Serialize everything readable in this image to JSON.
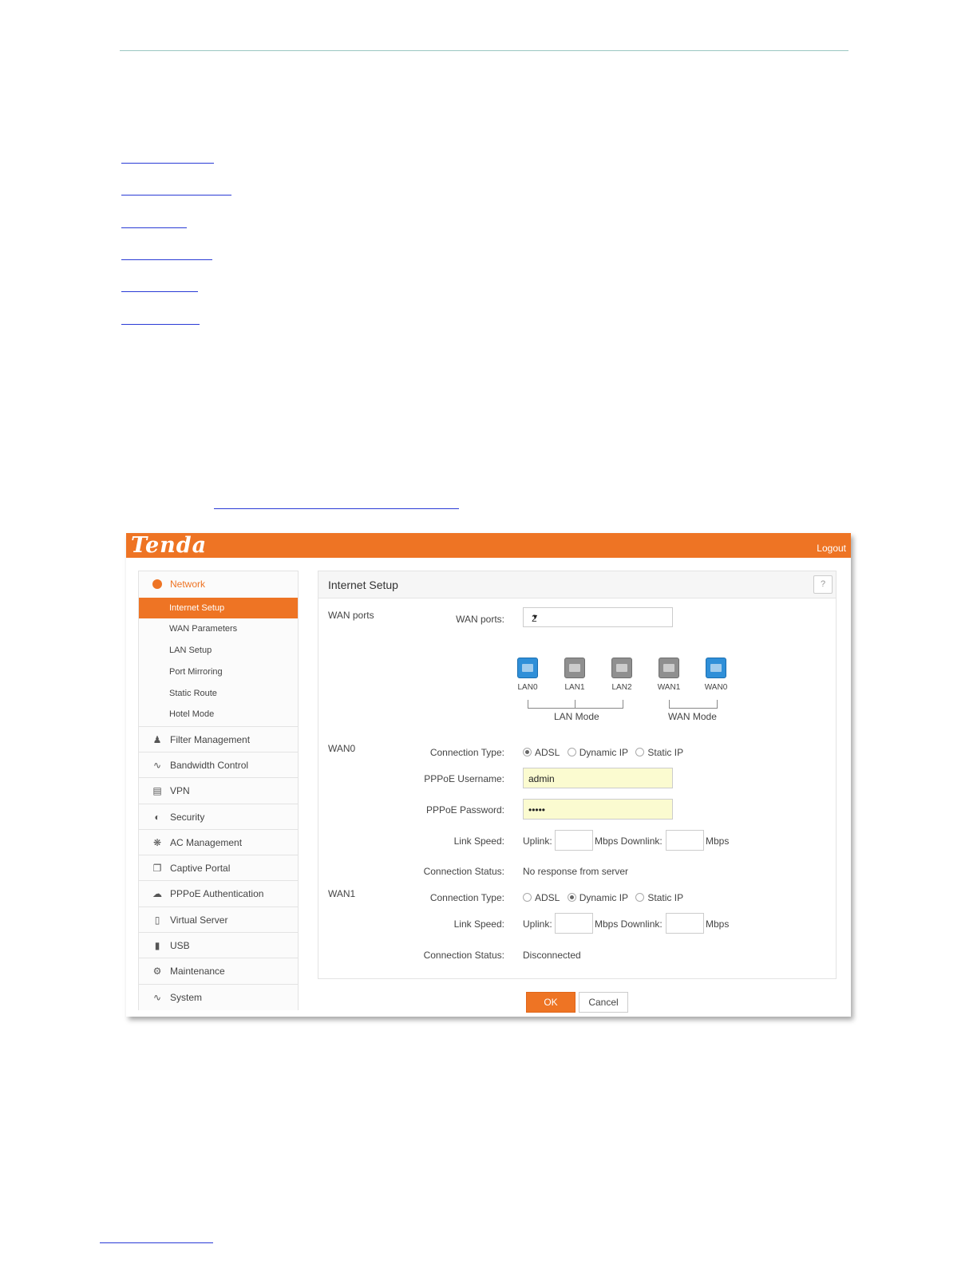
{
  "brand": {
    "logo": "Tenda",
    "accent": "#ee7424"
  },
  "header": {
    "logout": "Logout"
  },
  "sidebar": {
    "network": {
      "label": "Network",
      "icon": "globe-icon"
    },
    "network_items": [
      "Internet Setup",
      "WAN Parameters",
      "LAN Setup",
      "Port Mirroring",
      "Static Route",
      "Hotel Mode"
    ],
    "active_item": "Internet Setup",
    "menu": [
      {
        "label": "Filter Management",
        "icon": "user-filter-icon"
      },
      {
        "label": "Bandwidth Control",
        "icon": "chart-line-icon"
      },
      {
        "label": "VPN",
        "icon": "monitor-icon"
      },
      {
        "label": "Security",
        "icon": "shield-icon"
      },
      {
        "label": "AC Management",
        "icon": "antenna-icon"
      },
      {
        "label": "Captive Portal",
        "icon": "portal-icon"
      },
      {
        "label": "PPPoE Authentication",
        "icon": "cloud-icon"
      },
      {
        "label": "Virtual Server",
        "icon": "server-icon"
      },
      {
        "label": "USB",
        "icon": "usb-icon"
      },
      {
        "label": "Maintenance",
        "icon": "gear-icon"
      },
      {
        "label": "System",
        "icon": "pulse-icon"
      }
    ]
  },
  "panel": {
    "title": "Internet Setup",
    "help": "?",
    "wan_ports_section": "WAN ports",
    "wan_ports_label": "WAN ports:",
    "wan_ports_value": "2",
    "ports": [
      {
        "name": "LAN0",
        "color": "blue"
      },
      {
        "name": "LAN1",
        "color": "gray"
      },
      {
        "name": "LAN2",
        "color": "gray"
      },
      {
        "name": "WAN1",
        "color": "gray"
      },
      {
        "name": "WAN0",
        "color": "blue"
      }
    ],
    "lan_mode": "LAN Mode",
    "wan_mode": "WAN Mode",
    "wan0": {
      "section": "WAN0",
      "connection_type_label": "Connection Type:",
      "options": [
        "ADSL",
        "Dynamic IP",
        "Static IP"
      ],
      "selected": "ADSL",
      "username_label": "PPPoE Username:",
      "username_value": "admin",
      "password_label": "PPPoE Password:",
      "password_value": "•••••",
      "link_speed_label": "Link Speed:",
      "uplink": "Uplink:",
      "mbps_downlink": "Mbps Downlink:",
      "mbps": "Mbps",
      "status_label": "Connection Status:",
      "status_value": "No response from server"
    },
    "wan1": {
      "section": "WAN1",
      "connection_type_label": "Connection Type:",
      "options": [
        "ADSL",
        "Dynamic IP",
        "Static IP"
      ],
      "selected": "Dynamic IP",
      "link_speed_label": "Link Speed:",
      "uplink": "Uplink:",
      "mbps_downlink": "Mbps Downlink:",
      "mbps": "Mbps",
      "status_label": "Connection Status:",
      "status_value": "Disconnected"
    }
  },
  "buttons": {
    "ok": "OK",
    "cancel": "Cancel"
  }
}
